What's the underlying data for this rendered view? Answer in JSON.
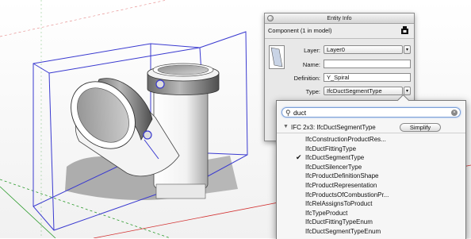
{
  "entity_info": {
    "title": "Entity Info",
    "header": "Component (1 in model)",
    "fields": [
      {
        "label": "Layer:",
        "value": "Layer0",
        "type": "dropdown"
      },
      {
        "label": "Name:",
        "value": "",
        "type": "text"
      },
      {
        "label": "Definition:",
        "value": "Y_Spiral",
        "type": "text"
      },
      {
        "label": "Type:",
        "value": "IfcDuctSegmentType",
        "type": "dropdown"
      }
    ],
    "dropdown_arrow": "▾"
  },
  "ifc_popup": {
    "search_value": "duct",
    "search_icon": "magnifier-icon",
    "clear_icon": "×",
    "tree_header": "IFC 2x3: IfcDuctSegmentType",
    "simplify_label": "Simplify",
    "items": [
      {
        "label": "IfcConstructionProductRes...",
        "checked": false
      },
      {
        "label": "IfcDuctFittingType",
        "checked": false
      },
      {
        "label": "IfcDuctSegmentType",
        "checked": true
      },
      {
        "label": "IfcDuctSilencerType",
        "checked": false
      },
      {
        "label": "IfcProductDefinitionShape",
        "checked": false
      },
      {
        "label": "IfcProductRepresentation",
        "checked": false
      },
      {
        "label": "IfcProductsOfCombustionPr...",
        "checked": false
      },
      {
        "label": "IfcRelAssignsToProduct",
        "checked": false
      },
      {
        "label": "IfcTypeProduct",
        "checked": false
      },
      {
        "label": "IfcDuctFittingTypeEnum",
        "checked": false
      },
      {
        "label": "IfcDuctSegmentTypeEnum",
        "checked": false
      }
    ],
    "check_glyph": "✔"
  },
  "colors": {
    "bounding_box": "#3a3ad0",
    "axis_red": "#d23030",
    "axis_green": "#2a9a2a"
  }
}
